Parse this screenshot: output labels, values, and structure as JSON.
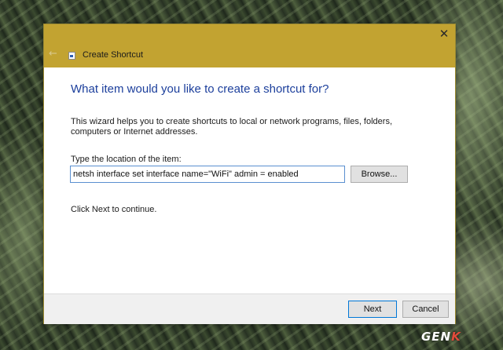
{
  "window": {
    "title": "Create Shortcut",
    "close_symbol": "✕",
    "back_symbol": "←",
    "icon": "shortcut-icon"
  },
  "content": {
    "heading": "What item would you like to create a shortcut for?",
    "description": "This wizard helps you to create shortcuts to local or network programs, files, folders, computers or Internet addresses.",
    "location_label": "Type the location of the item:",
    "location_value": "netsh interface set interface name=\"WiFi\" admin = enabled",
    "browse_label": "Browse...",
    "continue_text": "Click Next to continue."
  },
  "footer": {
    "next_label": "Next",
    "cancel_label": "Cancel"
  },
  "watermark": {
    "text_main": "GEN",
    "text_accent": "K",
    "accent_color": "#e14b3b"
  },
  "colors": {
    "titlebar": "#c2a331",
    "heading": "#1c3f9c",
    "input_border": "#5a8fd0"
  }
}
